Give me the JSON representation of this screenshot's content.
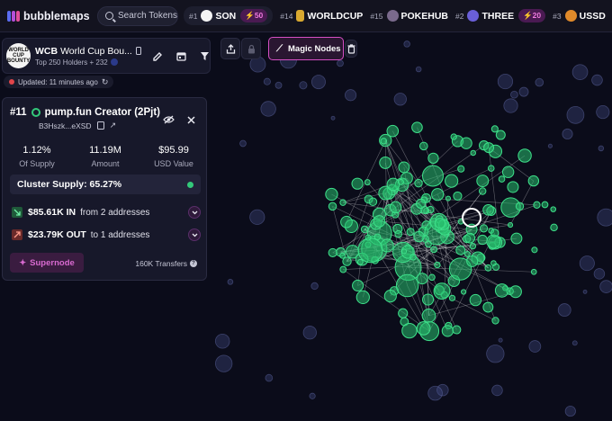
{
  "app": {
    "name": "bubblemaps"
  },
  "search": {
    "placeholder": "Search Tokens"
  },
  "trending": [
    {
      "rank": "#1",
      "name": "SON",
      "boost": "50"
    },
    {
      "rank": "#14",
      "name": "WORLDCUP"
    },
    {
      "rank": "#15",
      "name": "POKEHUB"
    },
    {
      "rank": "#2",
      "name": "THREE",
      "boost": "20"
    },
    {
      "rank": "#3",
      "name": "USSD"
    }
  ],
  "token": {
    "logo_text": "WORLD CUP BOUNTY",
    "symbol": "WCB",
    "name": "World Cup Bou...",
    "holders": "Top 250 Holders + 232",
    "updated": "Updated: 11 minutes ago"
  },
  "tools": {
    "magic_nodes_label": "Magic Nodes"
  },
  "node": {
    "rank": "#11",
    "title": "pump.fun Creator (2Pjt)",
    "address": "B3Hszk...eXSD",
    "stats": [
      {
        "value": "1.12%",
        "label": "Of Supply"
      },
      {
        "value": "11.19M",
        "label": "Amount"
      },
      {
        "value": "$95.99",
        "label": "USD Value"
      }
    ],
    "cluster_supply": "Cluster Supply: 65.27%",
    "in": {
      "amount": "$85.61K IN",
      "desc": "from 2 addresses"
    },
    "out": {
      "amount": "$23.79K OUT",
      "desc": "to 1 addresses"
    },
    "supernode_label": "Supernode",
    "transfers": "160K Transfers"
  },
  "colors": {
    "accent": "#d54fc4",
    "green": "#33c97a",
    "background": "#0b0c1a"
  }
}
